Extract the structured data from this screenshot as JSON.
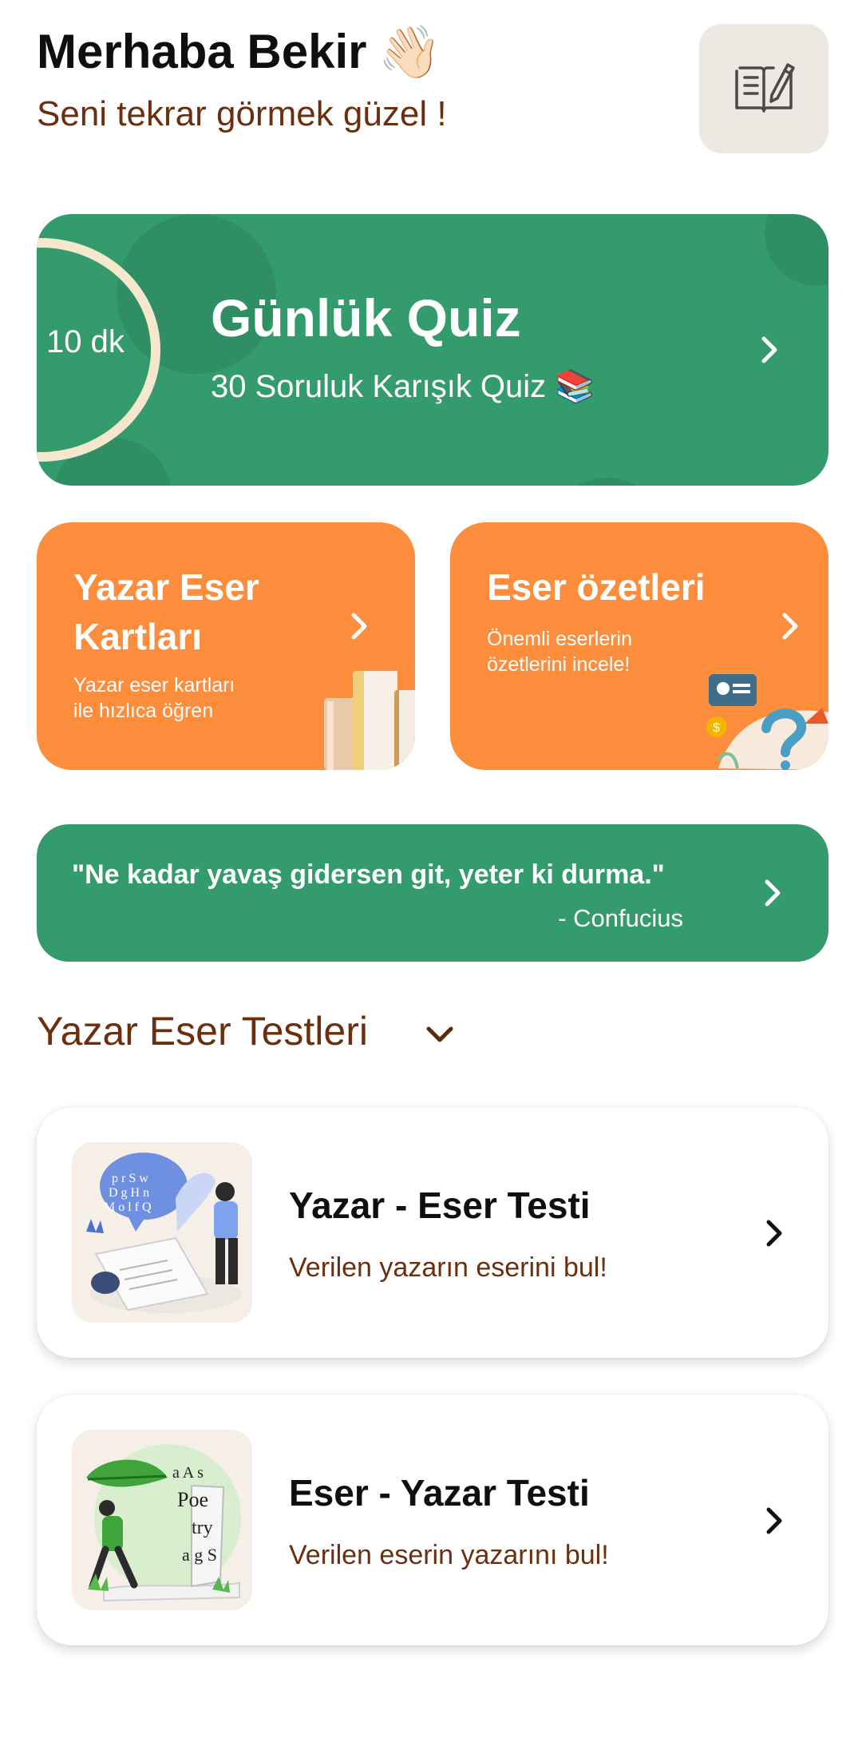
{
  "header": {
    "greeting": "Merhaba Bekir",
    "greeting_emoji": "👋🏻",
    "subtitle": "Seni tekrar görmek güzel !",
    "notes_icon": "notebook-pencil-icon"
  },
  "daily_quiz": {
    "timer_label": "10 dk",
    "title": "Günlük Quiz",
    "subtitle": "30 Soruluk Karışık Quiz 📚"
  },
  "cards": [
    {
      "title": "Yazar Eser Kartları",
      "desc_line1": "Yazar eser kartları",
      "desc_line2": "ile hızlıca öğren",
      "icon": "books-icon"
    },
    {
      "title": "Eser özetleri",
      "desc_line1": "Önemli eserlerin",
      "desc_line2": "özetlerini incele!",
      "icon": "summary-illustration-icon"
    }
  ],
  "quote": {
    "text": "\"Ne kadar yavaş gidersen git, yeter ki durma.\"",
    "author": "- Confucius"
  },
  "section": {
    "title": "Yazar Eser Testleri"
  },
  "tests": [
    {
      "title": "Yazar - Eser Testi",
      "subtitle": "Verilen yazarın eserini bul!"
    },
    {
      "title": "Eser - Yazar Testi",
      "subtitle": "Verilen eserin yazarını bul!"
    }
  ],
  "colors": {
    "green": "#349b6d",
    "orange": "#fb8d3c",
    "brown_text": "#6b2f0f",
    "ring": "#f4e7cc"
  }
}
